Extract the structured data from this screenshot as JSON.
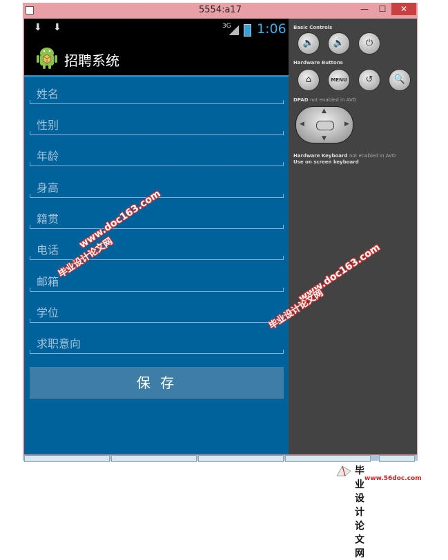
{
  "window": {
    "title": "5554:a17"
  },
  "status_bar": {
    "network": "3G",
    "time": "1:06"
  },
  "app": {
    "title": "招聘系统"
  },
  "form": {
    "fields": [
      {
        "placeholder": "姓名"
      },
      {
        "placeholder": "性别"
      },
      {
        "placeholder": "年龄"
      },
      {
        "placeholder": "身高"
      },
      {
        "placeholder": "籍贯"
      },
      {
        "placeholder": "电话"
      },
      {
        "placeholder": "邮箱"
      },
      {
        "placeholder": "学位"
      },
      {
        "placeholder": "求职意向"
      }
    ],
    "save_label": "保 存"
  },
  "controls": {
    "basic_title": "Basic Controls",
    "hardware_title": "Hardware Buttons",
    "menu_label": "MENU",
    "dpad_title": "DPAD",
    "dpad_note": "not enabled in AVD",
    "keyboard_title": "Hardware Keyboard",
    "keyboard_note": "not enabled in AVD",
    "keyboard_note2": "Use on screen keyboard"
  },
  "watermark": {
    "url": "www.doc163.com",
    "cn": "毕业设计论文网",
    "brand_url": "www.56doc.com"
  }
}
